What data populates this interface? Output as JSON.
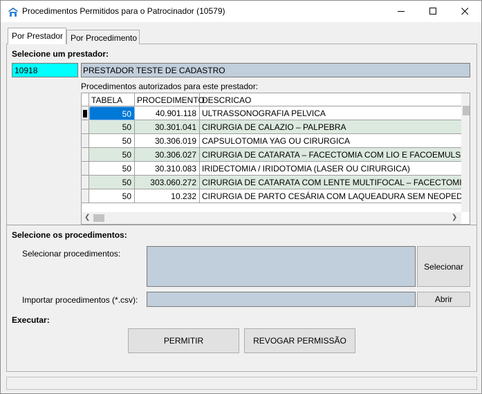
{
  "window": {
    "title": "Procedimentos Permitidos para o Patrocinador (10579)"
  },
  "tabs": [
    {
      "label": "Por Prestador",
      "active": true
    },
    {
      "label": "Por Procedimento",
      "active": false
    }
  ],
  "prestador": {
    "section_label": "Selecione um prestador:",
    "code": "10918",
    "name": "PRESTADOR TESTE DE CADASTRO",
    "grid_caption": "Procedimentos autorizados para este prestador:"
  },
  "grid": {
    "columns": [
      "TABELA",
      "PROCEDIMENTO",
      "DESCRICAO"
    ],
    "rows": [
      {
        "tabela": "50",
        "procedimento": "40.901.118",
        "descricao": "ULTRASSONOGRAFIA PELVICA"
      },
      {
        "tabela": "50",
        "procedimento": "30.301.041",
        "descricao": "CIRURGIA DE CALAZIO – PALPEBRA"
      },
      {
        "tabela": "50",
        "procedimento": "30.306.019",
        "descricao": "CAPSULOTOMIA YAG OU CIRURGICA"
      },
      {
        "tabela": "50",
        "procedimento": "30.306.027",
        "descricao": "CIRURGIA DE CATARATA – FACECTOMIA COM LIO E FACOEMULSIFICA"
      },
      {
        "tabela": "50",
        "procedimento": "30.310.083",
        "descricao": "IRIDECTOMIA / IRIDOTOMIA (LASER OU CIRURGICA)"
      },
      {
        "tabela": "50",
        "procedimento": "303.060.272",
        "descricao": "CIRURGIA DE CATARATA COM LENTE MULTIFOCAL – FACECTOMIA CO"
      },
      {
        "tabela": "50",
        "procedimento": "10.232",
        "descricao": "CIRURGIA DE PARTO CESÁRIA COM LAQUEADURA SEM NEOPEDIATRA"
      }
    ]
  },
  "procedimentos": {
    "section_label": "Selecione os procedimentos:",
    "select_label": "Selecionar procedimentos:",
    "select_button": "Selecionar",
    "import_label": "Importar procedimentos (*.csv):",
    "import_button": "Abrir"
  },
  "executar": {
    "section_label": "Executar:",
    "permit_button": "PERMITIR",
    "revoke_button": "REVOGAR PERMISSÃO"
  },
  "colors": {
    "selected": "#0078d7",
    "alt_row": "#dce9df",
    "code_field": "#00ffff",
    "readonly_field": "#c1cedb"
  }
}
